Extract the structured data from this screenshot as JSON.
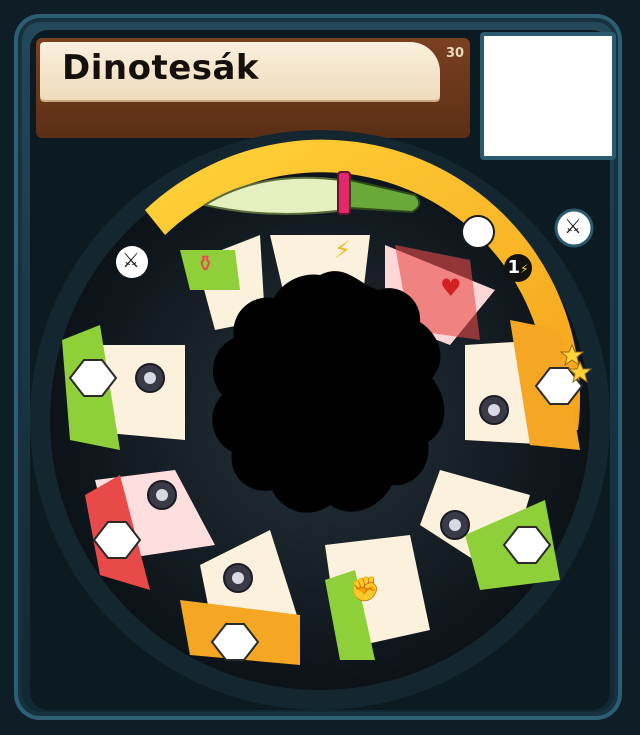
{
  "card": {
    "title": "Dinotesák",
    "cost": "30",
    "energy_cost": "1",
    "weapon": "dagger",
    "attack_type": "sword-icon",
    "rating": 2
  },
  "wheel": {
    "slices": [
      {
        "label_icon": "sword-icon",
        "color": "#8fd03a"
      },
      {
        "label_icon": "lightning-icon",
        "color": "#f1d44c"
      },
      {
        "label_icon": "heart-icon",
        "color": "#e84a4a"
      },
      {
        "label_icon": "target-icon",
        "color": "#f5a623"
      },
      {
        "label_icon": "target-icon",
        "color": "#8fd03a"
      },
      {
        "label_icon": "fist-icon",
        "color": "#8fd03a"
      },
      {
        "label_icon": "target-icon",
        "color": "#f5a623"
      },
      {
        "label_icon": "target-icon",
        "color": "#e84a4a"
      },
      {
        "label_icon": "target-icon",
        "color": "#8fd03a"
      }
    ]
  },
  "colors": {
    "frame": "#22495a",
    "accent": "#f5b21a",
    "green": "#8fd03a",
    "red": "#e84a4a",
    "orange": "#f5a623"
  }
}
